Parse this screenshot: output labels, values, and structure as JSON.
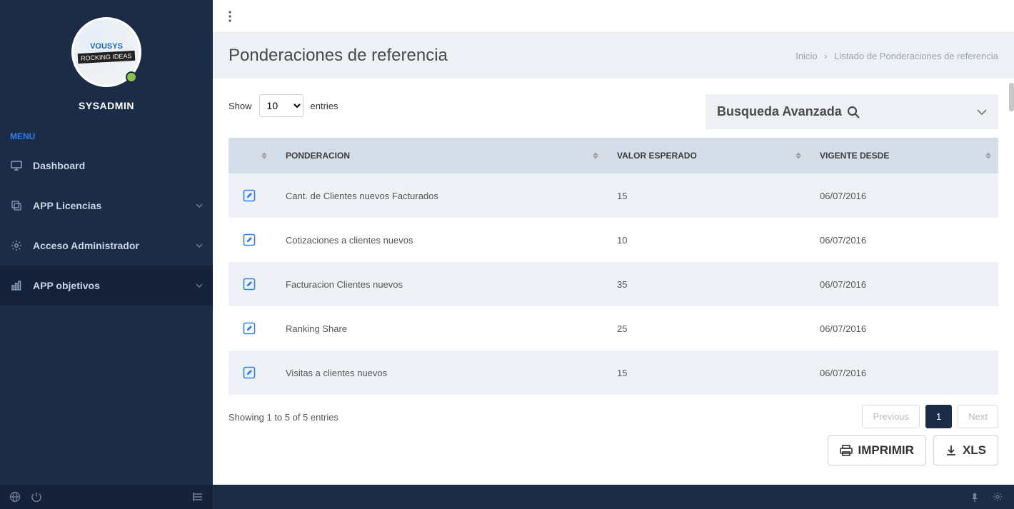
{
  "profile": {
    "username": "SYSADMIN",
    "brand": "VOUSYS",
    "tag": "ROCKING IDEAS"
  },
  "menu": {
    "header": "MENU",
    "items": [
      {
        "label": "Dashboard",
        "icon": "monitor",
        "expandable": false
      },
      {
        "label": "APP Licencias",
        "icon": "layers",
        "expandable": true
      },
      {
        "label": "Acceso Administrador",
        "icon": "gear",
        "expandable": true
      },
      {
        "label": "APP objetivos",
        "icon": "chart",
        "expandable": true
      }
    ]
  },
  "page": {
    "title": "Ponderaciones de referencia",
    "breadcrumb": {
      "home": "Inicio",
      "current": "Listado de Ponderaciones de referencia"
    }
  },
  "controls": {
    "show_label": "Show",
    "entries_label": "entries",
    "page_size": "10",
    "adv_search": "Busqueda Avanzada"
  },
  "table": {
    "headers": {
      "ponderacion": "PONDERACION",
      "valor": "VALOR ESPERADO",
      "vigente": "VIGENTE DESDE"
    },
    "rows": [
      {
        "ponderacion": "Cant. de Clientes nuevos Facturados",
        "valor": "15",
        "vigente": "06/07/2016"
      },
      {
        "ponderacion": "Cotizaciones a clientes nuevos",
        "valor": "10",
        "vigente": "06/07/2016"
      },
      {
        "ponderacion": "Facturacion Clientes nuevos",
        "valor": "35",
        "vigente": "06/07/2016"
      },
      {
        "ponderacion": "Ranking Share",
        "valor": "25",
        "vigente": "06/07/2016"
      },
      {
        "ponderacion": "Visitas a clientes nuevos",
        "valor": "15",
        "vigente": "06/07/2016"
      }
    ]
  },
  "footer": {
    "info": "Showing 1 to 5 of 5 entries",
    "prev": "Previous",
    "next": "Next",
    "current_page": "1",
    "print": "IMPRIMIR",
    "xls": "XLS"
  }
}
